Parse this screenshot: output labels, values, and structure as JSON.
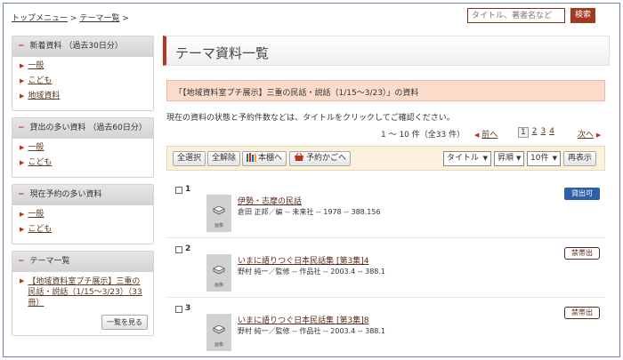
{
  "breadcrumb": {
    "items": [
      "トップメニュー",
      "テーマ一覧"
    ],
    "sep": ">"
  },
  "search": {
    "placeholder": "タイトル、著者名など",
    "button": "検索"
  },
  "sidebar": {
    "new": {
      "heading": "新着資料 （過去30日分）",
      "items": [
        "一般",
        "こども",
        "地域資料"
      ]
    },
    "popular_loans": {
      "heading": "貸出の多い資料 （過去60日分）",
      "items": [
        "一般",
        "こども"
      ]
    },
    "reserved": {
      "heading": "現在予約の多い資料",
      "items": [
        "一般",
        "こども"
      ]
    },
    "themes": {
      "heading": "テーマ一覧",
      "items": [
        "【地域資料室プチ展示】三重の民話・説話（1/15～3/23）（33 冊）"
      ],
      "more": "一覧を見る"
    }
  },
  "main": {
    "title": "テーマ資料一覧",
    "theme_label": "「【地域資料室プチ展示】三重の民話・説話（1/15～3/23）」の資料",
    "description": "現在の資料の状態と予約件数などは、タイトルをクリックしてご確認ください。",
    "count": "1 ～ 10 件（全33 件）",
    "prev": "前へ",
    "next": "次へ",
    "pages": [
      "1",
      "2",
      "3",
      "4"
    ],
    "current_page": "1"
  },
  "toolbar": {
    "select_all": "全選択",
    "deselect_all": "全解除",
    "shelf": "本棚へ",
    "cart": "予約かごへ",
    "sort_field": "タイトル",
    "sort_order": "昇順",
    "per_page": "10件",
    "redisplay": "再表示"
  },
  "records": [
    {
      "num": "1",
      "title": "伊勢・志摩の民話",
      "meta": "倉田 正邦／編 -- 未来社 -- 1978 -- 388.156",
      "status": "貸出可",
      "status_type": "available"
    },
    {
      "num": "2",
      "title": "いまに語りつぐ日本民話集 [第3集]4",
      "meta": "野村 純一／監修 -- 作品社 -- 2003.4 -- 388.1",
      "status": "禁帯出",
      "status_type": "noloan"
    },
    {
      "num": "3",
      "title": "いまに語りつぐ日本民話集 [第3集]8",
      "meta": "野村 純一／監修 -- 作品社 -- 2003.4 -- 388.1",
      "status": "禁帯出",
      "status_type": "noloan"
    }
  ],
  "thumb_label": "画像",
  "colors": {
    "accent": "#b8361e",
    "available_badge": "#2f5fa8",
    "theme_box": "#fbdccb",
    "toolbar_bg": "#fbf2de"
  }
}
